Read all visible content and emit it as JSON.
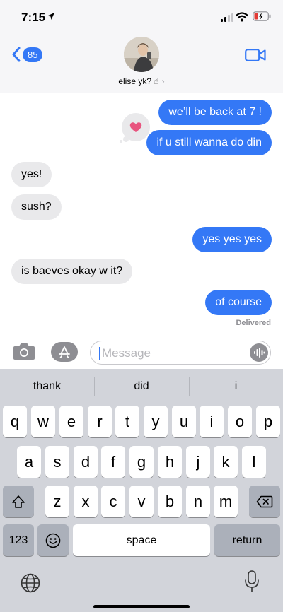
{
  "status_bar": {
    "time": "7:15"
  },
  "header": {
    "back_badge": "85",
    "contact_name": "elise yk? ☝",
    "contact_chevron": "›"
  },
  "messages": [
    {
      "text": "we’ll be back at 7 !",
      "direction": "outgoing"
    },
    {
      "text": "if u still wanna do din",
      "direction": "outgoing",
      "reaction": "heart"
    },
    {
      "text": "yes!",
      "direction": "incoming"
    },
    {
      "text": "sush?",
      "direction": "incoming"
    },
    {
      "text": "yes yes yes",
      "direction": "outgoing"
    },
    {
      "text": "is baeves okay w it?",
      "direction": "incoming"
    },
    {
      "text": "of course",
      "direction": "outgoing"
    }
  ],
  "delivered_label": "Delivered",
  "composer": {
    "placeholder": "Message"
  },
  "keyboard": {
    "suggestions": [
      "thank",
      "did",
      "i"
    ],
    "row1": [
      "q",
      "w",
      "e",
      "r",
      "t",
      "y",
      "u",
      "i",
      "o",
      "p"
    ],
    "row2": [
      "a",
      "s",
      "d",
      "f",
      "g",
      "h",
      "j",
      "k",
      "l"
    ],
    "row3": [
      "z",
      "x",
      "c",
      "v",
      "b",
      "n",
      "m"
    ],
    "numbers_key": "123",
    "space_key": "space",
    "return_key": "return"
  },
  "colors": {
    "outgoing_bubble": "#3478f6",
    "incoming_bubble": "#e9e9eb",
    "reaction_heart": "#e8557f"
  }
}
